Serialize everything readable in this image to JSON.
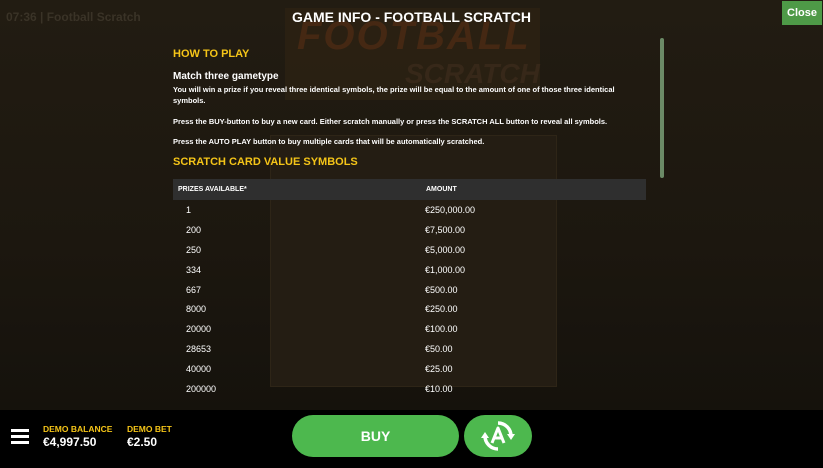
{
  "header": {
    "game_clock": "07:36 | Football Scratch",
    "title": "GAME INFO - FOOTBALL SCRATCH",
    "close_label": "Close"
  },
  "how_to_play": {
    "title": "HOW TO PLAY",
    "subtitle": "Match three gametype",
    "paragraphs": [
      "You will win a prize if you reveal three identical symbols, the prize will be equal to the amount of one of those three identical symbols.",
      "Press the BUY-button to buy a new card. Either scratch manually or press the SCRATCH ALL button to reveal all symbols.",
      "Press the AUTO PLAY button to buy multiple cards that will be automatically scratched."
    ]
  },
  "symbols": {
    "title": "SCRATCH CARD VALUE SYMBOLS",
    "columns": [
      "PRIZES AVAILABLE*",
      "AMOUNT"
    ],
    "rows": [
      [
        "1",
        "€250,000.00"
      ],
      [
        "200",
        "€7,500.00"
      ],
      [
        "250",
        "€5,000.00"
      ],
      [
        "334",
        "€1,000.00"
      ],
      [
        "667",
        "€500.00"
      ],
      [
        "8000",
        "€250.00"
      ],
      [
        "20000",
        "€100.00"
      ],
      [
        "28653",
        "€50.00"
      ],
      [
        "40000",
        "€25.00"
      ],
      [
        "200000",
        "€10.00"
      ]
    ]
  },
  "footer": {
    "balance_label": "DEMO BALANCE",
    "balance_value": "€4,997.50",
    "bet_label": "DEMO BET",
    "bet_value": "€2.50",
    "buy_label": "BUY"
  },
  "icons": {
    "menu": "hamburger-menu-icon",
    "autoplay": "autoplay-icon"
  },
  "colors": {
    "accent_yellow": "#f5c518",
    "button_green": "#4db84e",
    "close_green": "#4e9a47"
  }
}
